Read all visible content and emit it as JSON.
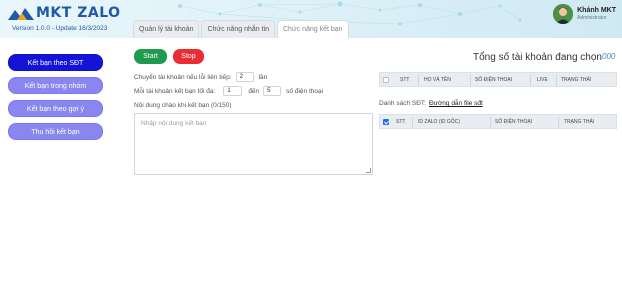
{
  "app": {
    "logo_text": "MKT ZALO",
    "version": "Version 1.0.0 - Update 16/3/2023"
  },
  "tabs": [
    {
      "label": "Quản lý tài khoản",
      "active": false
    },
    {
      "label": "Chức năng nhắn tin",
      "active": false
    },
    {
      "label": "Chức năng kết bạn",
      "active": true
    }
  ],
  "user": {
    "name": "Khánh MKT",
    "role": "Administrator"
  },
  "sidebar": {
    "items": [
      {
        "label": "Kết bạn theo SĐT",
        "active": true
      },
      {
        "label": "Kết bạn trong nhóm",
        "active": false
      },
      {
        "label": "Kết bạn theo gợi ý",
        "active": false
      },
      {
        "label": "Thu hồi kết bạn",
        "active": false
      }
    ]
  },
  "actions": {
    "start_label": "Start",
    "stop_label": "Stop"
  },
  "form": {
    "retry_label": "Chuyển tài khoản nếu lỗi liên tiếp:",
    "retry_value": "2",
    "retry_unit": "lần",
    "max_label": "Mỗi tài khoản kết bạn tối đa:",
    "max_from": "1",
    "max_mid": "đến",
    "max_to": "5",
    "max_unit": "số điện thoại",
    "message_label": "Nội dung chào khi kết bạn (0/150)",
    "message_placeholder": "Nhập nội dung kết bạn"
  },
  "accounts": {
    "total_label": "Tổng số tài khoản đang chọn",
    "total_value": "000",
    "columns": [
      "STT",
      "HỌ VÀ TÊN",
      "SỐ ĐIỆN THOẠI",
      "LIVE",
      "TRẠNG THÁI"
    ]
  },
  "phone_list": {
    "label": "Danh sách SĐT:",
    "link": "Đường dẫn file sđt",
    "columns": [
      "STT",
      "ID ZALO (ID GỐC)",
      "SỐ ĐIỆN THOẠI",
      "TRẠNG THÁI"
    ]
  },
  "colors": {
    "sidebar_active": "#1414d8",
    "sidebar_button": "#8a86f0",
    "start": "#1f9a4e",
    "stop": "#ea2d35",
    "brand": "#1e5aa8"
  }
}
